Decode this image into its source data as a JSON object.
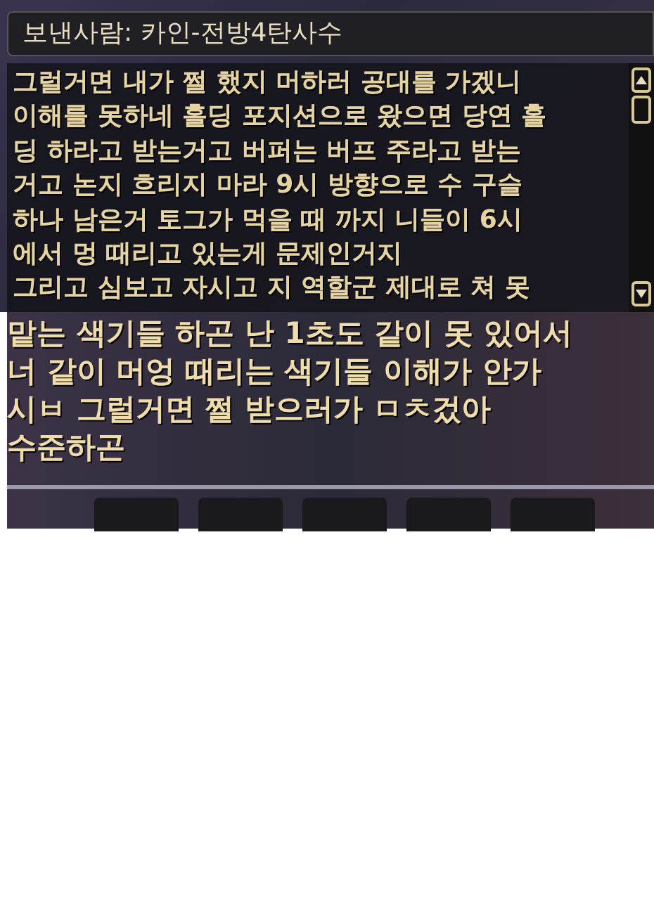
{
  "message_window": {
    "sender": "보낸사람: 카인-전방4탄사수",
    "lines": [
      "그럴거면 내가 쩔 했지 머하러 공대를 가겠니",
      "이해를 못하네 홀딩 포지션으로 왔으면 당연 홀",
      "딩 하라고 받는거고 버퍼는 버프 주라고 받는",
      "거고 논지 흐리지 마라 9시 방향으로 수 구슬",
      "하나 남은거 토그가 먹을 때 까지 니들이 6시",
      "에서 멍 때리고 있는게 문제인거지",
      "그리고 심보고 자시고 지 역할군 제대로 쳐 못"
    ]
  },
  "continued_window": {
    "lines": [
      "맡는 색기들 하곤 난 1초도 같이 못 있어서",
      "너 같이 머엉 때리는 색기들 이해가 안가",
      "시ㅂ 그럴거면 쩔 받으러가 ㅁㅊ겄아",
      "수준하곤"
    ],
    "buttons": [
      {
        "kind": "blank"
      },
      {
        "kind": "blank"
      },
      {
        "kind": "blank"
      },
      {
        "kind": "blank"
      },
      {
        "kind": "blank"
      }
    ]
  }
}
